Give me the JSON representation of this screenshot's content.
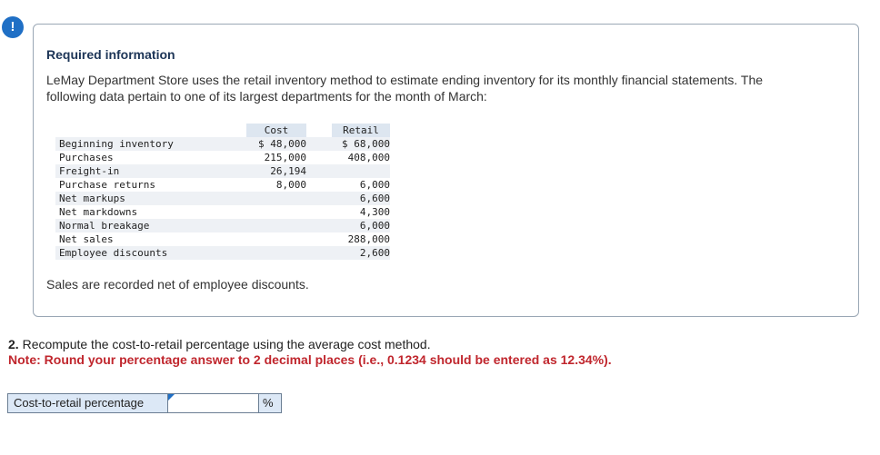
{
  "alert": {
    "glyph": "!",
    "icon": "exclamation-icon",
    "color": "#1f6fc5"
  },
  "info": {
    "title": "Required information",
    "intro": "LeMay Department Store uses the retail inventory method to estimate ending inventory for its monthly financial statements. The following data pertain to one of its largest departments for the month of March:",
    "table": {
      "headers": {
        "label": "",
        "cost": "Cost",
        "retail": "Retail"
      },
      "rows": [
        {
          "label": "Beginning inventory",
          "cost": "$ 48,000",
          "retail": "$ 68,000"
        },
        {
          "label": "Purchases",
          "cost": "215,000",
          "retail": "408,000"
        },
        {
          "label": "Freight-in",
          "cost": "26,194",
          "retail": ""
        },
        {
          "label": "Purchase returns",
          "cost": "8,000",
          "retail": "6,000"
        },
        {
          "label": "Net markups",
          "cost": "",
          "retail": "6,600"
        },
        {
          "label": "Net markdowns",
          "cost": "",
          "retail": "4,300"
        },
        {
          "label": "Normal breakage",
          "cost": "",
          "retail": "6,000"
        },
        {
          "label": "Net sales",
          "cost": "",
          "retail": "288,000"
        },
        {
          "label": "Employee discounts",
          "cost": "",
          "retail": "2,600"
        }
      ]
    },
    "footer": "Sales are recorded net of employee discounts."
  },
  "question": {
    "number": "2.",
    "text": " Recompute the cost-to-retail percentage using the average cost method.",
    "note": "Note: Round your percentage answer to 2 decimal places (i.e., 0.1234 should be entered as 12.34%)."
  },
  "answer": {
    "label": "Cost-to-retail percentage",
    "value": "",
    "unit": "%"
  },
  "colors": {
    "accent": "#1f6fc5",
    "note_red": "#c0262d",
    "label_bg": "#dce8f6"
  }
}
